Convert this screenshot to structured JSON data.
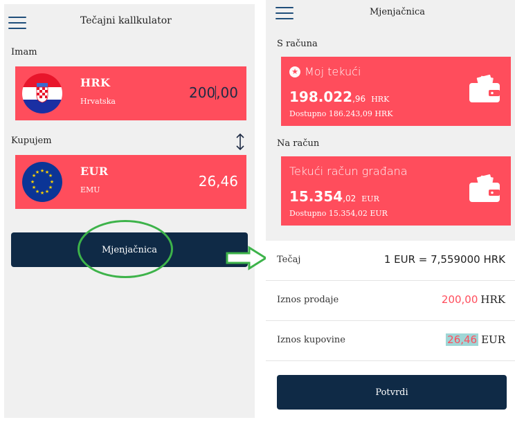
{
  "calculator": {
    "title": "Tečajni kallkulator",
    "have_label": "Imam",
    "buy_label": "Kupujem",
    "from": {
      "code": "HRK",
      "country": "Hrvatska",
      "amount_int": "200",
      "amount_dec": ",00"
    },
    "to": {
      "code": "EUR",
      "country": "EMU",
      "amount": "26,46"
    },
    "exchange_button": "Mjenjačnica"
  },
  "exchange": {
    "title": "Mjenjačnica",
    "from_label": "S računa",
    "to_label": "Na račun",
    "from_account": {
      "name": "Moj tekući",
      "balance_int": "198.022",
      "balance_dec": ",96",
      "currency": "HRK",
      "available": "Dostupno 186.243,09 HRK"
    },
    "to_account": {
      "name": "Tekući račun građana",
      "balance_int": "15.354",
      "balance_dec": ",02",
      "currency": "EUR",
      "available": "Dostupno 15.354,02 EUR"
    },
    "rate_label": "Tečaj",
    "rate_value": "1 EUR = 7,559000 HRK",
    "sell_label": "Iznos prodaje",
    "sell_amount": "200,00",
    "sell_currency": "HRK",
    "buy_label": "Iznos kupovine",
    "buy_amount": "26,46",
    "buy_currency": "EUR",
    "confirm_button": "Potvrdi"
  },
  "colors": {
    "card_red": "#ff4d5c",
    "navy": "#0f2a46",
    "annotation_green": "#3db34a",
    "highlight": "#9fd6d6"
  },
  "icons": [
    "menu-icon",
    "swap-icon",
    "croatia-flag-icon",
    "eu-flag-icon",
    "star-icon",
    "wallet-icon",
    "arrow-right-icon"
  ]
}
